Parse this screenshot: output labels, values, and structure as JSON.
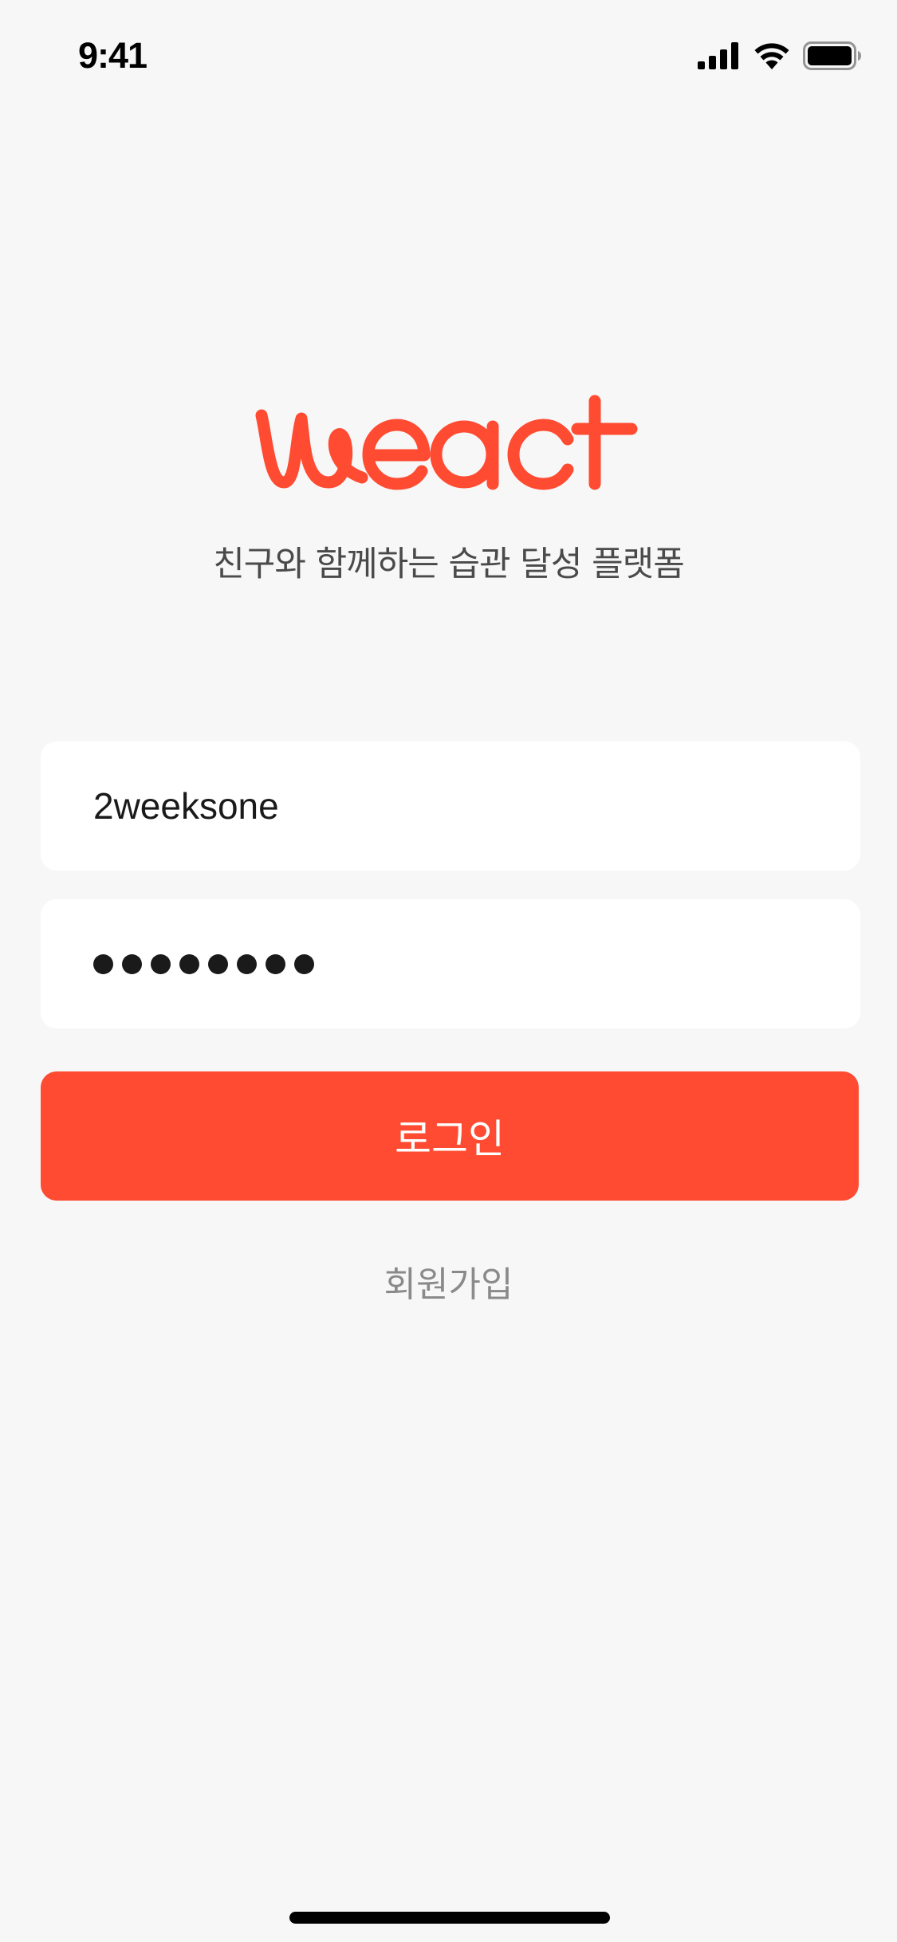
{
  "status_bar": {
    "time": "9:41",
    "icons": [
      "cellular-signal-icon",
      "wifi-icon",
      "battery-icon"
    ]
  },
  "brand": {
    "logo_text": "weact",
    "color": "#ff4b31",
    "tagline": "친구와 함께하는 습관 달성 플랫폼"
  },
  "login_form": {
    "username_value": "2weeksone",
    "password_masked": "••••••••",
    "password_length": 8,
    "login_label": "로그인",
    "signup_label": "회원가입"
  },
  "colors": {
    "background": "#f7f7f7",
    "accent": "#ff4b31",
    "field_background": "#ffffff",
    "secondary_text": "#8a8a8a"
  }
}
